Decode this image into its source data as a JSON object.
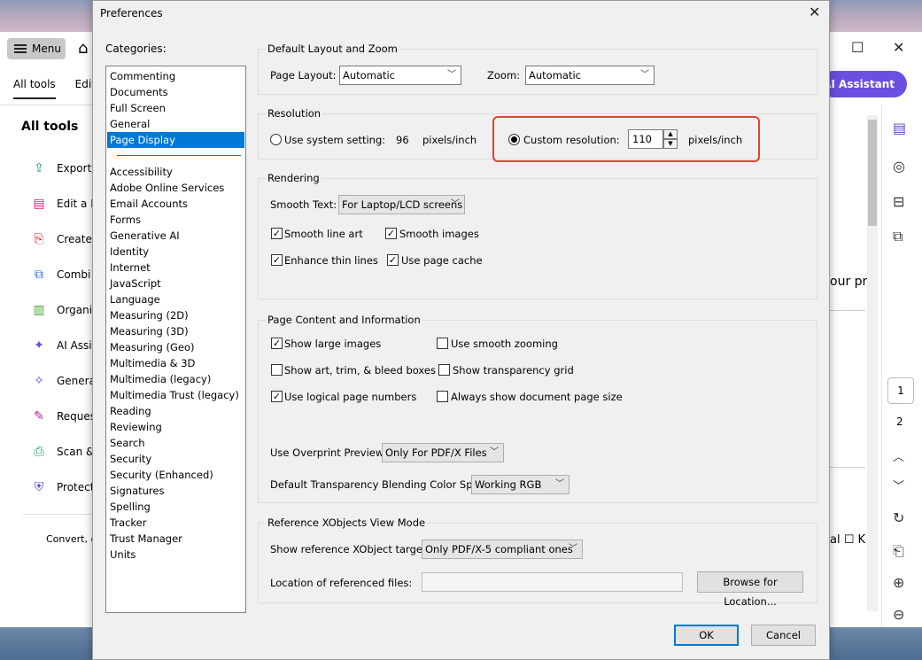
{
  "background_app": {
    "menu_label": "Menu",
    "tabs": [
      "All tools",
      "Edit"
    ],
    "ai_assistant_label": "AI Assistant",
    "all_tools_title": "All tools",
    "tools": [
      "Export",
      "Edit a P",
      "Create",
      "Combi",
      "Organi",
      "AI Assis",
      "Genera",
      "Reques",
      "Scan &",
      "Protect"
    ],
    "convert_text": "Convert, e",
    "doc_fragment_1": "our pr",
    "doc_fragment_2": "al ☐ K",
    "pages": [
      "1",
      "2"
    ]
  },
  "dialog": {
    "title": "Preferences",
    "categories_label": "Categories:",
    "categories_top": [
      "Commenting",
      "Documents",
      "Full Screen",
      "General",
      "Page Display"
    ],
    "categories_bottom": [
      "Accessibility",
      "Adobe Online Services",
      "Email Accounts",
      "Forms",
      "Generative AI",
      "Identity",
      "Internet",
      "JavaScript",
      "Language",
      "Measuring (2D)",
      "Measuring (3D)",
      "Measuring (Geo)",
      "Multimedia & 3D",
      "Multimedia (legacy)",
      "Multimedia Trust (legacy)",
      "Reading",
      "Reviewing",
      "Search",
      "Security",
      "Security (Enhanced)",
      "Signatures",
      "Spelling",
      "Tracker",
      "Trust Manager",
      "Units"
    ],
    "selected_category": "Page Display",
    "layout_zoom": {
      "title": "Default Layout and Zoom",
      "page_layout_label": "Page Layout:",
      "page_layout_value": "Automatic",
      "zoom_label": "Zoom:",
      "zoom_value": "Automatic"
    },
    "resolution": {
      "title": "Resolution",
      "use_system_label": "Use system setting:",
      "system_value": "96",
      "system_unit": "pixels/inch",
      "custom_label": "Custom resolution:",
      "custom_value": "110",
      "custom_unit": "pixels/inch",
      "selected": "custom"
    },
    "rendering": {
      "title": "Rendering",
      "smooth_text_label": "Smooth Text:",
      "smooth_text_value": "For Laptop/LCD screens",
      "smooth_line_art": "Smooth line art",
      "smooth_images": "Smooth images",
      "enhance_thin_lines": "Enhance thin lines",
      "use_page_cache": "Use page cache"
    },
    "page_content": {
      "title": "Page Content and Information",
      "show_large_images": "Show large images",
      "use_smooth_zooming": "Use smooth zooming",
      "show_art_trim": "Show art, trim, & bleed boxes",
      "show_transparency_grid": "Show transparency grid",
      "use_logical_page_numbers": "Use logical page numbers",
      "always_show_doc_page_size": "Always show document page size",
      "overprint_label": "Use Overprint Preview:",
      "overprint_value": "Only For PDF/X Files",
      "blend_label": "Default Transparency Blending Color Space:",
      "blend_value": "Working RGB"
    },
    "xobjects": {
      "title": "Reference XObjects View Mode",
      "show_targets_label": "Show reference XObject targets:",
      "show_targets_value": "Only PDF/X-5 compliant ones",
      "location_label": "Location of referenced files:",
      "location_value": "",
      "browse_label": "Browse for Location..."
    },
    "ok_label": "OK",
    "cancel_label": "Cancel"
  }
}
